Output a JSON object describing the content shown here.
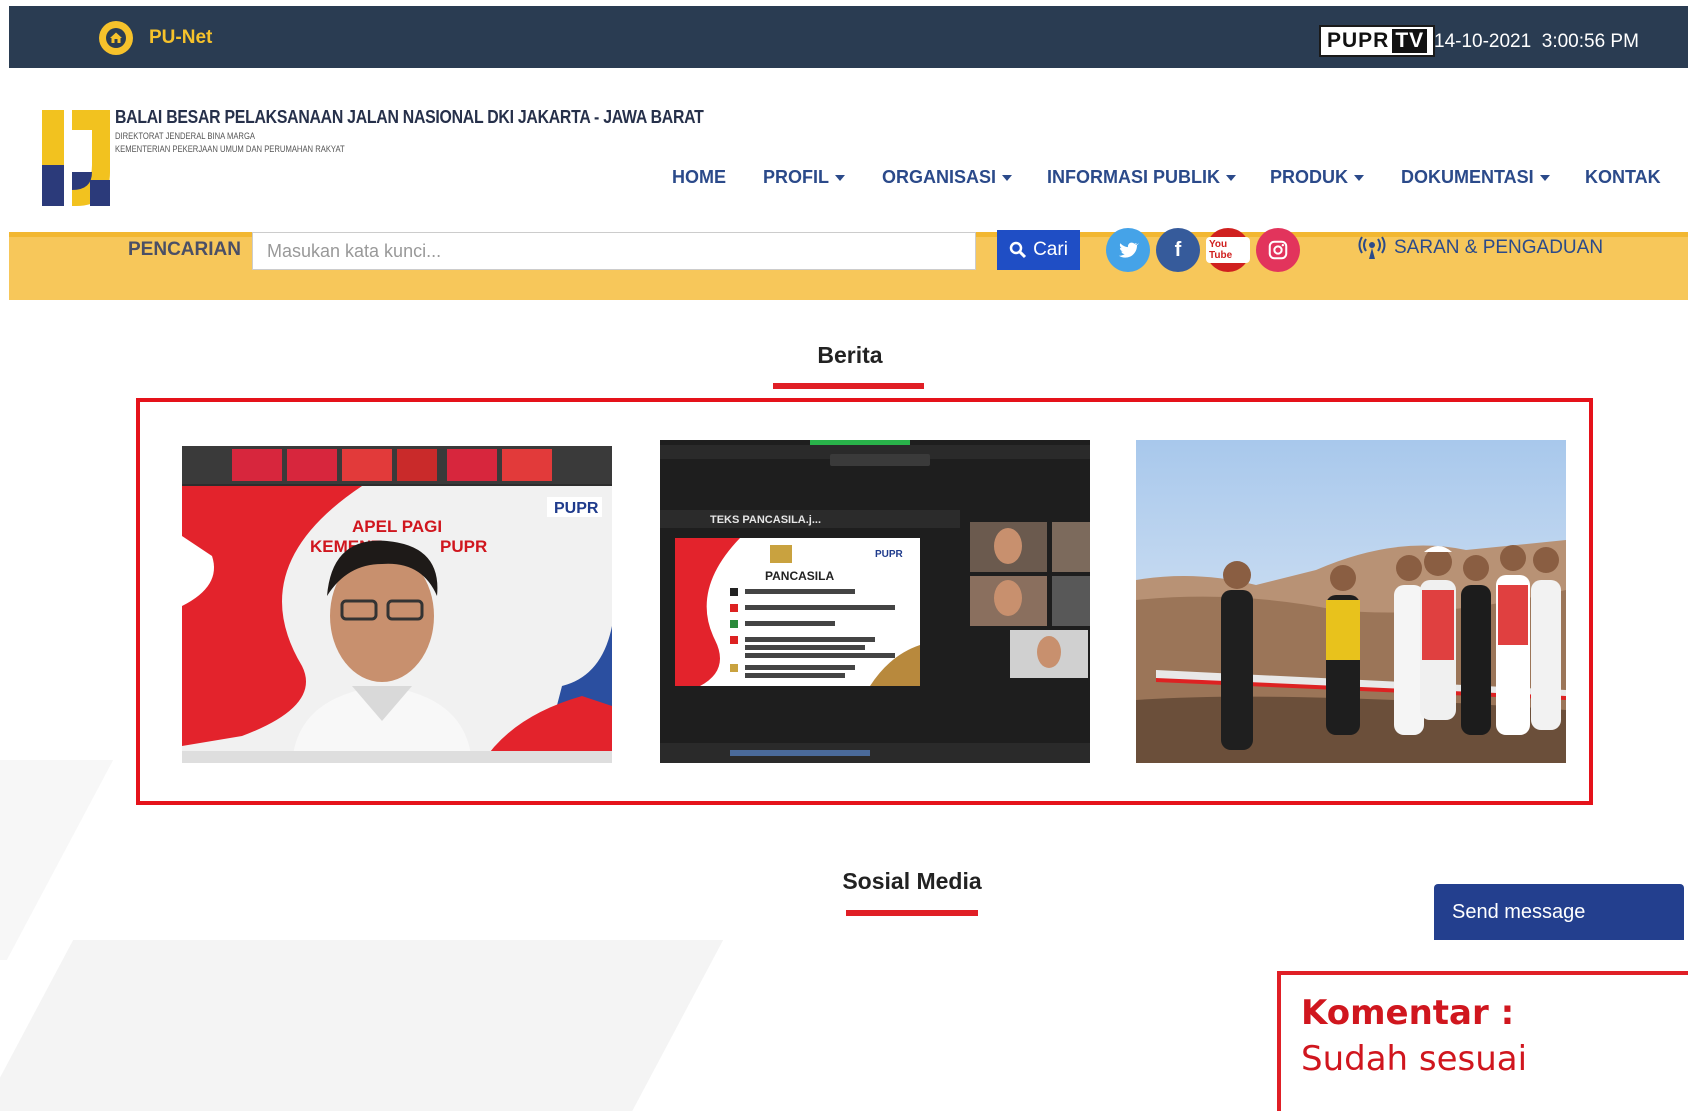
{
  "topbar": {
    "site_name": "PU-Net",
    "tv_logo_left": "PUPR",
    "tv_logo_right": "TV",
    "date": "14-10-2021",
    "time": "3:00:56 PM"
  },
  "header": {
    "org_name": "BALAI BESAR PELAKSANAAN JALAN NASIONAL DKI JAKARTA - JAWA BARAT",
    "org_sub1": "DIREKTORAT JENDERAL BINA MARGA",
    "org_sub2": "KEMENTERIAN PEKERJAAN UMUM DAN PERUMAHAN RAKYAT"
  },
  "nav": {
    "items": [
      {
        "label": "HOME",
        "dropdown": false
      },
      {
        "label": "PROFIL",
        "dropdown": true
      },
      {
        "label": "ORGANISASI",
        "dropdown": true
      },
      {
        "label": "INFORMASI PUBLIK",
        "dropdown": true
      },
      {
        "label": "PRODUK",
        "dropdown": true
      },
      {
        "label": "DOKUMENTASI",
        "dropdown": true
      },
      {
        "label": "KONTAK",
        "dropdown": false
      }
    ]
  },
  "search": {
    "label": "PENCARIAN",
    "placeholder": "Masukan kata kunci...",
    "button_label": "Cari"
  },
  "social": {
    "twitter_glyph": "t",
    "facebook_glyph": "f",
    "youtube_glyph": "You Tube",
    "instagram_glyph": "◎"
  },
  "saran_label": "SARAN & PENGADUAN",
  "berita": {
    "title": "Berita",
    "thumbs": [
      {
        "overlay_title": "APEL PAGI",
        "overlay_sub": "KEMENTERIAN PUPR",
        "brand": "PUPR"
      },
      {
        "toolbar_title": "TEKS PANCASILA.j...",
        "slide_title": "PANCASILA",
        "brand": "PUPR",
        "lines": [
          "1. KETUHANAN YANG MAHA ESA",
          "2. KEMANUSIAAN YANG ADIL DAN BERADAB",
          "3. PERSATUAN INDONESIA",
          "4. KERAKYATAN YANG DIPIMPIN OLEH HIKMAT KEBIJAKSANAAN",
          "5. KEADILAN SOSIAL BAGI SELURUH RAKYAT INDONESIA"
        ]
      },
      {}
    ]
  },
  "sosial_media": {
    "title": "Sosial Media"
  },
  "send_message": "Send message",
  "comment": {
    "title": "Komentar :",
    "body": "Sudah sesuai"
  },
  "colors": {
    "topbar": "#2a3c52",
    "accent_yellow": "#f6c22b",
    "nav_blue": "#2b4a8a",
    "red": "#e01f26"
  }
}
